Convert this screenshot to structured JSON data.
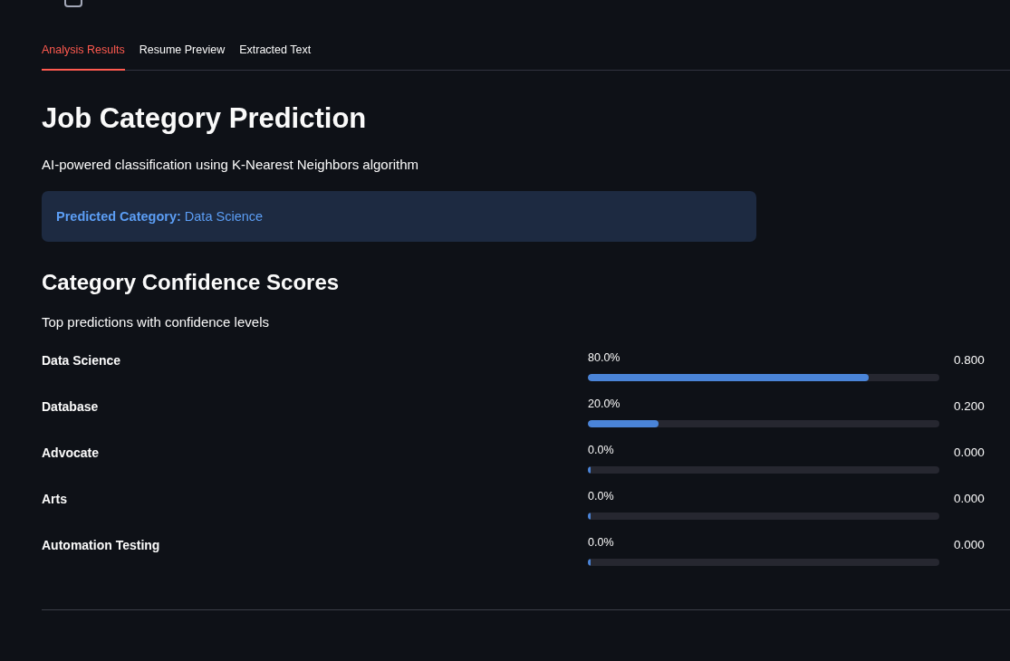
{
  "tabs": [
    {
      "label": "Analysis Results",
      "selected": true
    },
    {
      "label": "Resume Preview",
      "selected": false
    },
    {
      "label": "Extracted Text",
      "selected": false
    }
  ],
  "prediction": {
    "title": "Job Category Prediction",
    "subtitle": "AI-powered classification using K-Nearest Neighbors algorithm",
    "result": "**Predicted Category:** Data Science"
  },
  "confidence": {
    "title": "Category Confidence Scores",
    "subtitle": "Top predictions with confidence levels",
    "rows": [
      {
        "category": "Data Science",
        "percent": "80.0%",
        "level": 0.8,
        "score": "0.800"
      },
      {
        "category": "Database",
        "percent": "20.0%",
        "level": 0.2,
        "score": "0.200"
      },
      {
        "category": "Advocate",
        "percent": "0.0%",
        "level": 0,
        "score": "0.000"
      },
      {
        "category": "Arts",
        "percent": "0.0%",
        "level": 0,
        "score": "0.000"
      },
      {
        "category": "Automation Testing",
        "percent": "0.0%",
        "level": 0,
        "score": "0.000"
      }
    ]
  }
}
